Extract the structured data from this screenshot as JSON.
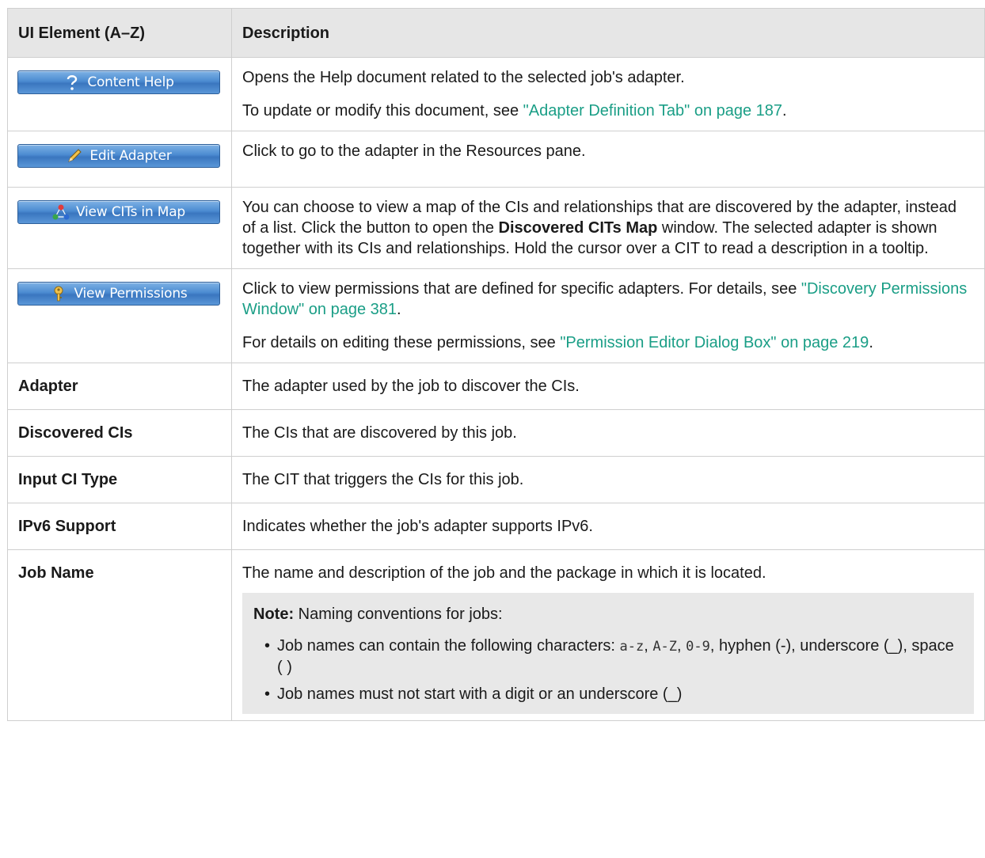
{
  "header": {
    "col_element": "UI Element (A–Z)",
    "col_description": "Description"
  },
  "colors": {
    "link": "#1a9e86",
    "header_bg": "#e6e6e6",
    "note_bg": "#e8e8e8",
    "button_blue": "#4b8bd1"
  },
  "rows": {
    "content_help": {
      "button_label": "Content Help",
      "icon": "help-question-icon",
      "line1": "Opens the Help document related to the selected job's adapter.",
      "line2_prefix": "To update or modify this document, see ",
      "line2_link": "\"Adapter Definition Tab\" on page 187",
      "line2_suffix": "."
    },
    "edit_adapter": {
      "button_label": "Edit Adapter",
      "icon": "pencil-icon",
      "text": "Click to go to the adapter in the Resources pane."
    },
    "view_cits": {
      "button_label": "View CITs in Map",
      "icon": "network-map-icon",
      "text_prefix": "You can choose to view a map of the CIs and relationships that are discovered by the adapter, instead of a list. Click the button to open the ",
      "text_bold": "Discovered CITs Map",
      "text_suffix": " window. The selected adapter is shown together with its CIs and relationships. Hold the cursor over a CIT to read a description in a tooltip."
    },
    "view_permissions": {
      "button_label": "View Permissions",
      "icon": "key-icon",
      "line1_prefix": "Click to view permissions that are defined for specific adapters. For details, see ",
      "line1_link": "\"Discovery Permissions Window\" on page 381",
      "line1_suffix": ".",
      "line2_prefix": "For details on editing these permissions, see ",
      "line2_link": "\"Permission Editor Dialog Box\" on page 219",
      "line2_suffix": "."
    },
    "adapter": {
      "label": "Adapter",
      "text": "The adapter used by the job to discover the CIs."
    },
    "discovered_cis": {
      "label": "Discovered CIs",
      "text": "The CIs that are discovered by this job."
    },
    "input_ci_type": {
      "label": "Input CI Type",
      "text": "The CIT that triggers the CIs for this job."
    },
    "ipv6_support": {
      "label": "IPv6 Support",
      "text": "Indicates whether the job's adapter supports IPv6."
    },
    "job_name": {
      "label": "Job Name",
      "text": "The name and description of the job and the package in which it is located.",
      "note_label": "Note:",
      "note_text": " Naming conventions for jobs:",
      "bullet1_prefix": "Job names can contain the following characters: ",
      "bullet1_code1": "a-z",
      "bullet1_sep1": ", ",
      "bullet1_code2": "A-Z",
      "bullet1_sep2": ", ",
      "bullet1_code3": "0-9",
      "bullet1_suffix": ", hyphen (-), underscore (_), space ( )",
      "bullet2": "Job names must not start with a digit or an underscore (_)"
    }
  }
}
